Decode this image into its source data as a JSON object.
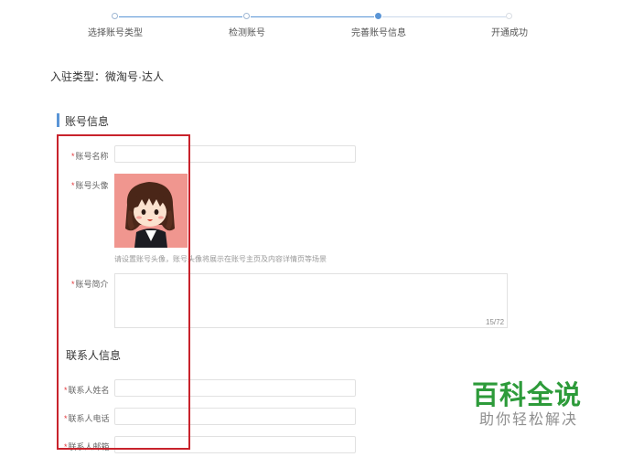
{
  "stepper": {
    "steps": [
      {
        "label": "选择账号类型",
        "state": "done"
      },
      {
        "label": "检测账号",
        "state": "done"
      },
      {
        "label": "完善账号信息",
        "state": "active"
      },
      {
        "label": "开通成功",
        "state": "pending"
      }
    ]
  },
  "account_type_line": "入驻类型：微淘号·达人",
  "account_section": {
    "title": "账号信息",
    "name_label": "账号名称",
    "avatar_label": "账号头像",
    "avatar_hint": "请设置账号头像，账号头像将展示在账号主页及内容详情页等场景",
    "intro_label": "账号简介",
    "intro_counter": "15/72"
  },
  "contact_section": {
    "title": "联系人信息",
    "name_label": "联系人姓名",
    "phone_label": "联系人电话",
    "email_label": "联系人邮箱"
  },
  "required_mark": "*",
  "watermark": {
    "title": "百科全说",
    "subtitle": "助你轻松解决"
  },
  "colors": {
    "accent": "#5a95d6",
    "highlight_box": "#c8232c",
    "required": "#e4393c",
    "watermark": "#2d9b3a"
  }
}
